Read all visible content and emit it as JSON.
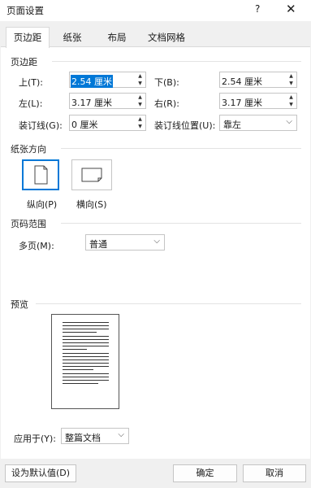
{
  "window": {
    "title": "页面设置",
    "help": "?",
    "close": "✕"
  },
  "tabs": [
    "页边距",
    "纸张",
    "布局",
    "文档网格"
  ],
  "margins": {
    "group_label": "页边距",
    "top_label": "上(T):",
    "top_value": "2.54 厘米",
    "bottom_label": "下(B):",
    "bottom_value": "2.54 厘米",
    "left_label": "左(L):",
    "left_value": "3.17 厘米",
    "right_label": "右(R):",
    "right_value": "3.17 厘米",
    "gutter_label": "装订线(G):",
    "gutter_value": "0 厘米",
    "gutter_pos_label": "装订线位置(U):",
    "gutter_pos_value": "靠左"
  },
  "orientation": {
    "group_label": "纸张方向",
    "portrait_label": "纵向(P)",
    "landscape_label": "横向(S)",
    "selected": "portrait"
  },
  "pages": {
    "group_label": "页码范围",
    "multiple_label": "多页(M):",
    "multiple_value": "普通"
  },
  "preview": {
    "group_label": "预览",
    "apply_label": "应用于(Y):",
    "apply_value": "整篇文档"
  },
  "buttons": {
    "default": "设为默认值(D)",
    "ok": "确定",
    "cancel": "取消"
  },
  "colors": {
    "accent": "#0078d7",
    "background": "#f0f0f0"
  }
}
